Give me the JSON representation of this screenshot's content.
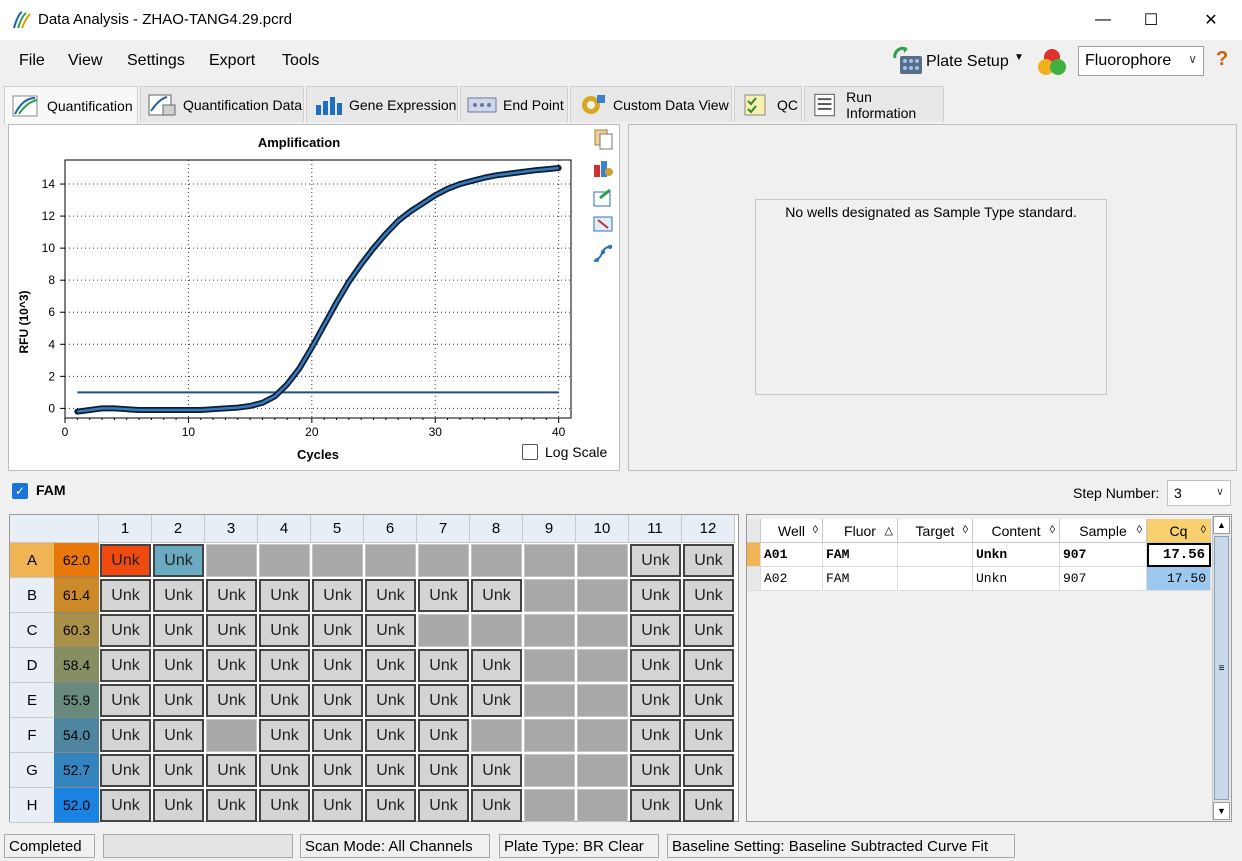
{
  "window": {
    "title": "Data Analysis - ZHAO-TANG4.29.pcrd",
    "minimize": "—",
    "maximize": "☐",
    "close": "✕"
  },
  "menu": {
    "file": "File",
    "view": "View",
    "settings": "Settings",
    "export": "Export",
    "tools": "Tools"
  },
  "toolbar": {
    "plate_setup": "Plate Setup",
    "fluor_select": "Fluorophore",
    "help": "?"
  },
  "tabs": [
    {
      "label": "Quantification",
      "icon": "amplification-curve-icon",
      "active": true
    },
    {
      "label": "Quantification Data",
      "icon": "data-sheet-icon"
    },
    {
      "label": "Gene Expression",
      "icon": "bar-graph-icon"
    },
    {
      "label": "End Point",
      "icon": "end-point-icon"
    },
    {
      "label": "Custom Data View",
      "icon": "gear-puzzle-icon"
    },
    {
      "label": "QC",
      "icon": "checklist-icon"
    },
    {
      "label": "Run Information",
      "icon": "document-list-icon"
    }
  ],
  "chart_data": {
    "type": "line",
    "title": "Amplification",
    "xlabel": "Cycles",
    "ylabel": "RFU (10^3)",
    "xlim": [
      0,
      41
    ],
    "ylim": [
      -0.6,
      15.5
    ],
    "xticks": [
      "0",
      "10",
      "20",
      "30",
      "40"
    ],
    "yticks": [
      "0",
      "2",
      "4",
      "6",
      "8",
      "10",
      "12",
      "14"
    ],
    "grid": true,
    "threshold": 1.0,
    "series": [
      {
        "x": [
          1,
          2,
          3,
          4,
          5,
          6,
          7,
          8,
          9,
          10,
          11,
          12,
          13,
          14,
          15,
          16,
          17,
          18,
          19,
          20,
          21,
          22,
          23,
          24,
          25,
          26,
          27,
          28,
          29,
          30,
          31,
          32,
          33,
          34,
          35,
          36,
          37,
          38,
          39,
          40
        ],
        "values": [
          -0.2,
          -0.1,
          0.0,
          0.0,
          -0.05,
          -0.1,
          -0.1,
          -0.1,
          -0.1,
          -0.1,
          -0.1,
          -0.05,
          0.0,
          0.05,
          0.15,
          0.35,
          0.75,
          1.5,
          2.5,
          3.8,
          5.2,
          6.6,
          7.9,
          9.0,
          10.0,
          10.9,
          11.7,
          12.3,
          12.8,
          13.3,
          13.7,
          14.0,
          14.2,
          14.4,
          14.55,
          14.65,
          14.75,
          14.85,
          14.92,
          15.0
        ]
      }
    ],
    "log_scale_label": "Log Scale"
  },
  "std_curve": {
    "message": "No wells designated as Sample Type standard."
  },
  "fam": {
    "label": "FAM",
    "step_label": "Step Number:",
    "step_value": "3"
  },
  "plate": {
    "columns": [
      "1",
      "2",
      "3",
      "4",
      "5",
      "6",
      "7",
      "8",
      "9",
      "10",
      "11",
      "12"
    ],
    "rows": [
      {
        "label": "A",
        "temp": "62.0",
        "color": "#e8780a",
        "wells": [
          "Unk",
          "Unk",
          "",
          "",
          "",
          "",
          "",
          "",
          "",
          "",
          "Unk",
          "Unk"
        ]
      },
      {
        "label": "B",
        "temp": "61.4",
        "color": "#cc8a2a",
        "wells": [
          "Unk",
          "Unk",
          "Unk",
          "Unk",
          "Unk",
          "Unk",
          "Unk",
          "Unk",
          "",
          "",
          "Unk",
          "Unk"
        ]
      },
      {
        "label": "C",
        "temp": "60.3",
        "color": "#a99048",
        "wells": [
          "Unk",
          "Unk",
          "Unk",
          "Unk",
          "Unk",
          "Unk",
          "",
          "",
          "",
          "",
          "Unk",
          "Unk"
        ]
      },
      {
        "label": "D",
        "temp": "58.4",
        "color": "#858f62",
        "wells": [
          "Unk",
          "Unk",
          "Unk",
          "Unk",
          "Unk",
          "Unk",
          "Unk",
          "Unk",
          "",
          "",
          "Unk",
          "Unk"
        ]
      },
      {
        "label": "E",
        "temp": "55.9",
        "color": "#678a7c",
        "wells": [
          "Unk",
          "Unk",
          "Unk",
          "Unk",
          "Unk",
          "Unk",
          "Unk",
          "Unk",
          "",
          "",
          "Unk",
          "Unk"
        ]
      },
      {
        "label": "F",
        "temp": "54.0",
        "color": "#4e86a0",
        "wells": [
          "Unk",
          "Unk",
          "",
          "Unk",
          "Unk",
          "Unk",
          "Unk",
          "",
          "",
          "",
          "Unk",
          "Unk"
        ]
      },
      {
        "label": "G",
        "temp": "52.7",
        "color": "#3484c0",
        "wells": [
          "Unk",
          "Unk",
          "Unk",
          "Unk",
          "Unk",
          "Unk",
          "Unk",
          "Unk",
          "",
          "",
          "Unk",
          "Unk"
        ]
      },
      {
        "label": "H",
        "temp": "52.0",
        "color": "#1a82e0",
        "wells": [
          "Unk",
          "Unk",
          "Unk",
          "Unk",
          "Unk",
          "Unk",
          "Unk",
          "Unk",
          "",
          "",
          "Unk",
          "Unk"
        ]
      }
    ],
    "highlight_a1": "#f04a10",
    "highlight_a2": "#6aaac0"
  },
  "results": {
    "headers": [
      "Well",
      "Fluor",
      "Target",
      "Content",
      "Sample",
      "Cq"
    ],
    "rows": [
      {
        "well": "A01",
        "fluor": "FAM",
        "target": "",
        "content": "Unkn",
        "sample": "907",
        "cq": "17.56"
      },
      {
        "well": "A02",
        "fluor": "FAM",
        "target": "",
        "content": "Unkn",
        "sample": "907",
        "cq": "17.50"
      }
    ]
  },
  "status": {
    "state": "Completed",
    "progress": "",
    "scan_mode": "Scan Mode: All Channels",
    "plate_type": "Plate Type: BR Clear",
    "baseline": "Baseline Setting: Baseline Subtracted Curve Fit"
  }
}
